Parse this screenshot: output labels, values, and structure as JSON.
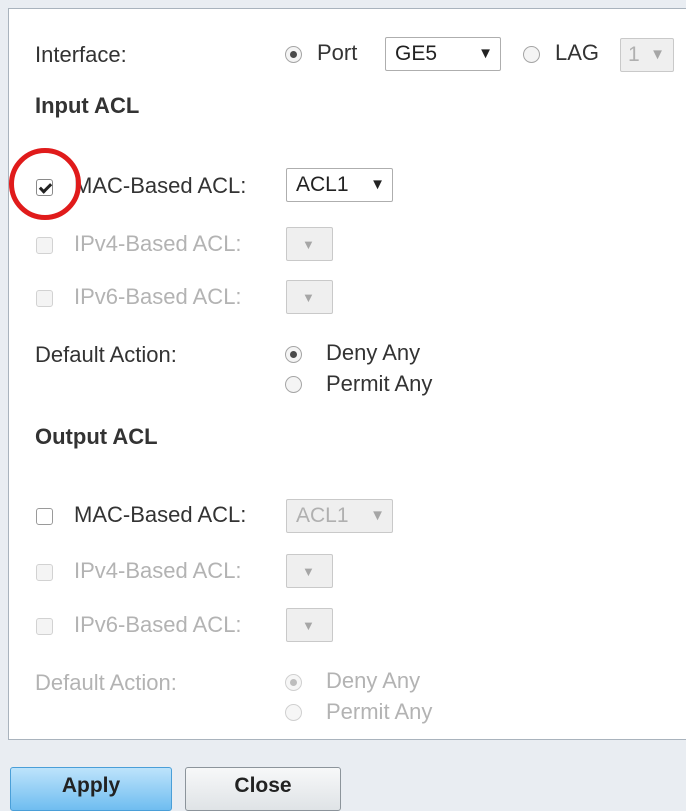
{
  "interface": {
    "label": "Interface:",
    "port_label": "Port",
    "port_value": "GE5",
    "lag_label": "LAG",
    "lag_value": "1"
  },
  "input_acl": {
    "heading": "Input ACL",
    "mac_label": "MAC-Based ACL:",
    "mac_value": "ACL1",
    "mac_checked": true,
    "ipv4_label": "IPv4-Based ACL:",
    "ipv6_label": "IPv6-Based ACL:",
    "default_action_label": "Default Action:",
    "deny_label": "Deny Any",
    "permit_label": "Permit Any",
    "selected_action": "Deny Any"
  },
  "output_acl": {
    "heading": "Output ACL",
    "mac_label": "MAC-Based ACL:",
    "mac_value": "ACL1",
    "mac_checked": false,
    "ipv4_label": "IPv4-Based ACL:",
    "ipv6_label": "IPv6-Based ACL:",
    "default_action_label": "Default Action:",
    "deny_label": "Deny Any",
    "permit_label": "Permit Any",
    "selected_action": "Deny Any"
  },
  "buttons": {
    "apply": "Apply",
    "close": "Close"
  },
  "icons": {
    "dropdown_arrow": "▼"
  },
  "colors": {
    "highlight": "#e01b1b",
    "apply_button": "#6fbdf0",
    "disabled_text": "#b3b3b3"
  }
}
